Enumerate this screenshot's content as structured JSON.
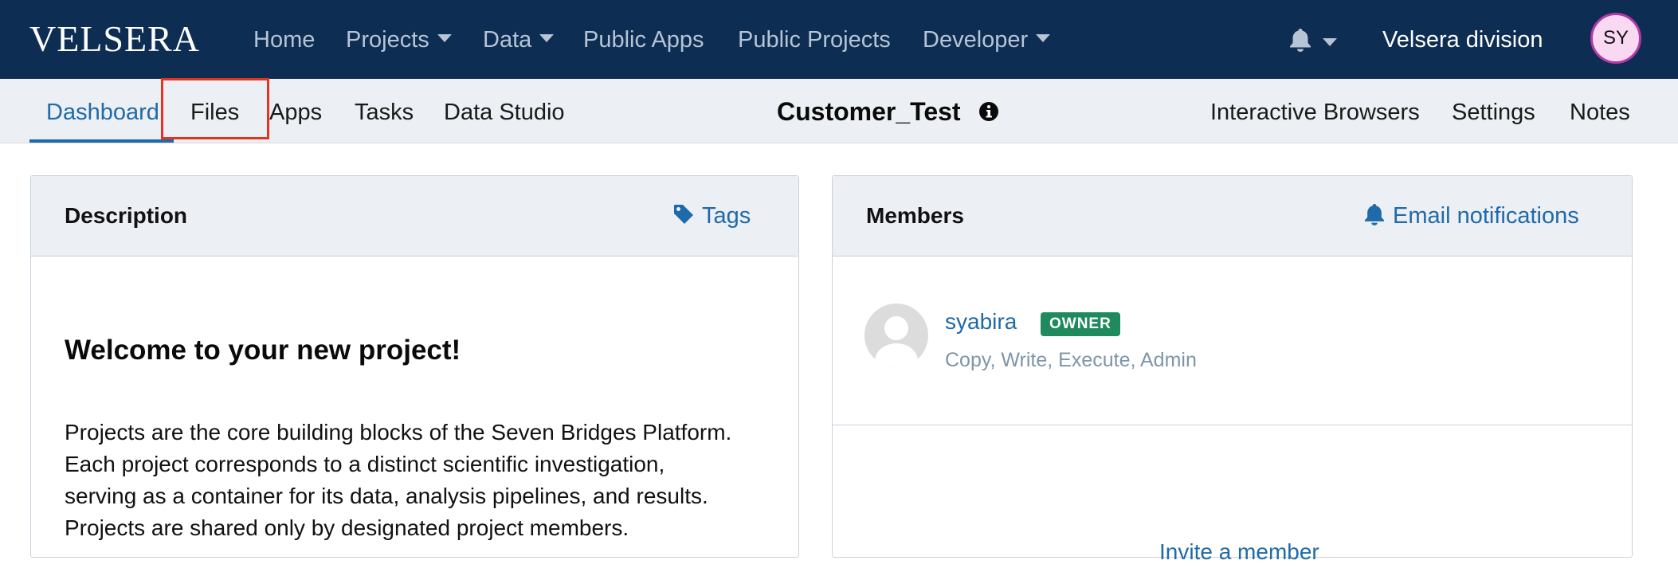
{
  "topnav": {
    "logo": "VELSERA",
    "items": [
      {
        "label": "Home",
        "has_dropdown": false
      },
      {
        "label": "Projects",
        "has_dropdown": true
      },
      {
        "label": "Data",
        "has_dropdown": true
      },
      {
        "label": "Public Apps",
        "has_dropdown": false
      },
      {
        "label": "Public Projects",
        "has_dropdown": false
      },
      {
        "label": "Developer",
        "has_dropdown": true
      }
    ],
    "notifications_icon": "bell-icon",
    "division": "Velsera division",
    "user_initials": "SY"
  },
  "subnav": {
    "tabs": [
      {
        "label": "Dashboard",
        "active": true
      },
      {
        "label": "Files",
        "active": false,
        "highlighted": true
      },
      {
        "label": "Apps",
        "active": false
      },
      {
        "label": "Tasks",
        "active": false
      },
      {
        "label": "Data Studio",
        "active": false
      }
    ],
    "project_title": "Customer_Test",
    "right_tabs": [
      {
        "label": "Interactive Browsers"
      },
      {
        "label": "Settings"
      },
      {
        "label": "Notes"
      }
    ]
  },
  "description_panel": {
    "heading": "Description",
    "tags_label": "Tags",
    "welcome_title": "Welcome to your new project!",
    "lines": [
      "Projects are the core building blocks of the Seven Bridges Platform.",
      "Each project corresponds to a distinct scientific investigation,",
      "serving as a container for its data, analysis pipelines, and results.",
      "Projects are shared only by designated project members."
    ]
  },
  "members_panel": {
    "heading": "Members",
    "email_notifications_label": "Email notifications",
    "members": [
      {
        "name": "syabira",
        "role": "OWNER",
        "permissions": "Copy, Write, Execute, Admin"
      }
    ],
    "invite_label": "Invite a member"
  },
  "colors": {
    "topnav_bg": "#0d2d52",
    "accent": "#1f6aa8",
    "owner_badge": "#1e8a5e",
    "highlight": "#e8321f"
  }
}
